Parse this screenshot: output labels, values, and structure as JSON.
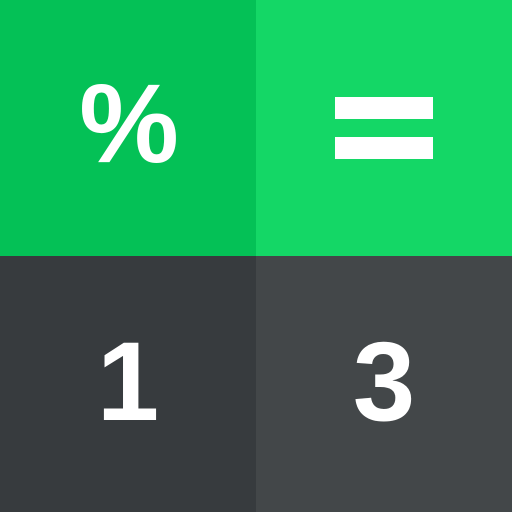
{
  "keypad": {
    "keys": [
      {
        "id": "percent",
        "label": "%",
        "color": "#04c156"
      },
      {
        "id": "equals",
        "label": "=",
        "icon": "equals-icon",
        "color": "#14d766"
      },
      {
        "id": "one",
        "label": "1",
        "color": "#373b3e"
      },
      {
        "id": "three",
        "label": "3",
        "color": "#434749"
      }
    ],
    "text_color": "#ffffff"
  }
}
